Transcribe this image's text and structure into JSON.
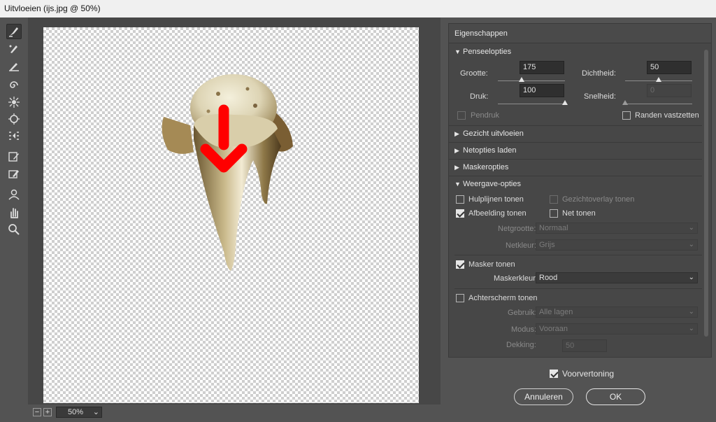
{
  "window": {
    "title": "Uitvloeien (ijs.jpg @ 50%)"
  },
  "tools": [
    "forward-warp-icon",
    "reconstruct-icon",
    "smooth-icon",
    "twirl-icon",
    "pucker-icon",
    "bloat-icon",
    "push-left-icon",
    "freeze-mask-icon",
    "thaw-mask-icon",
    "face-icon",
    "hand-icon",
    "zoom-icon"
  ],
  "zoom": {
    "minus": "−",
    "plus": "+",
    "value": "50%"
  },
  "panel": {
    "title": "Eigenschappen",
    "brush": {
      "header": "Penseelopties",
      "size_label": "Grootte:",
      "size_value": "175",
      "size_level": 0.35,
      "density_label": "Dichtheid:",
      "density_value": "50",
      "density_level": 0.5,
      "pressure_label": "Druk:",
      "pressure_value": "100",
      "pressure_level": 1.0,
      "rate_label": "Snelheid:",
      "rate_value": "0",
      "rate_level": 0.0,
      "stylus_label": "Pendruk",
      "pin_edges_label": "Randen vastzetten"
    },
    "sections": {
      "face": "Gezicht uitvloeien",
      "load_mesh": "Netopties laden",
      "mask": "Maskeropties",
      "view": "Weergave-opties"
    },
    "view": {
      "guides_label": "Hulplijnen tonen",
      "face_overlay_label": "Gezichtoverlay tonen",
      "image_label": "Afbeelding tonen",
      "mesh_label": "Net tonen",
      "mesh_size_label": "Netgrootte:",
      "mesh_size_value": "Normaal",
      "mesh_color_label": "Netkleur:",
      "mesh_color_value": "Grijs",
      "mask_label": "Masker tonen",
      "mask_color_label": "Maskerkleur:",
      "mask_color_value": "Rood",
      "backdrop_label": "Achterscherm tonen",
      "use_label": "Gebruik:",
      "use_value": "Alle lagen",
      "mode_label": "Modus:",
      "mode_value": "Vooraan",
      "opacity_label": "Dekking:",
      "opacity_value": "50"
    }
  },
  "footer": {
    "preview_label": "Voorvertoning",
    "cancel_label": "Annuleren",
    "ok_label": "OK"
  },
  "colors": {
    "accent_arrow": "#ff0000",
    "panel_bg": "#474747",
    "window_bg": "#535353"
  }
}
